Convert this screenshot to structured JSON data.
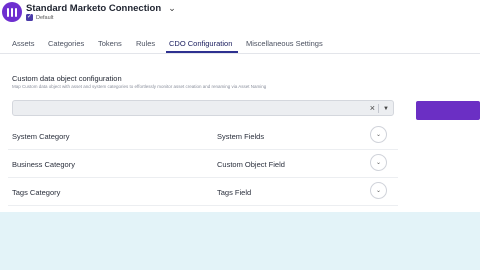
{
  "header": {
    "title": "Standard Marketo Connection",
    "default_label": "Default",
    "default_checked": true
  },
  "tabs": [
    {
      "label": "Assets"
    },
    {
      "label": "Categories"
    },
    {
      "label": "Tokens"
    },
    {
      "label": "Rules"
    },
    {
      "label": "CDO Configuration",
      "active": true
    },
    {
      "label": "Miscellaneous Settings"
    }
  ],
  "panel": {
    "title": "Custom data object configuration",
    "description": "Map Custom data object with asset and system categories to effortlessly monitor asset creation and renaming via Asset Naming",
    "select": {
      "value": ""
    },
    "rows": [
      {
        "left": "System Category",
        "right": "System Fields"
      },
      {
        "left": "Business Category",
        "right": "Custom Object Field"
      },
      {
        "left": "Tags Category",
        "right": "Tags Field"
      }
    ]
  },
  "colors": {
    "accent": "#6b2fc4",
    "tab_active": "#2e3190",
    "bottom_band": "#e3f3f8"
  },
  "icons": {
    "logo": "marketo-logo-icon",
    "chevron": "chevron-down-icon",
    "clear": "close-icon",
    "caret": "caret-down-icon",
    "row_toggle": "chevron-down-icon"
  }
}
